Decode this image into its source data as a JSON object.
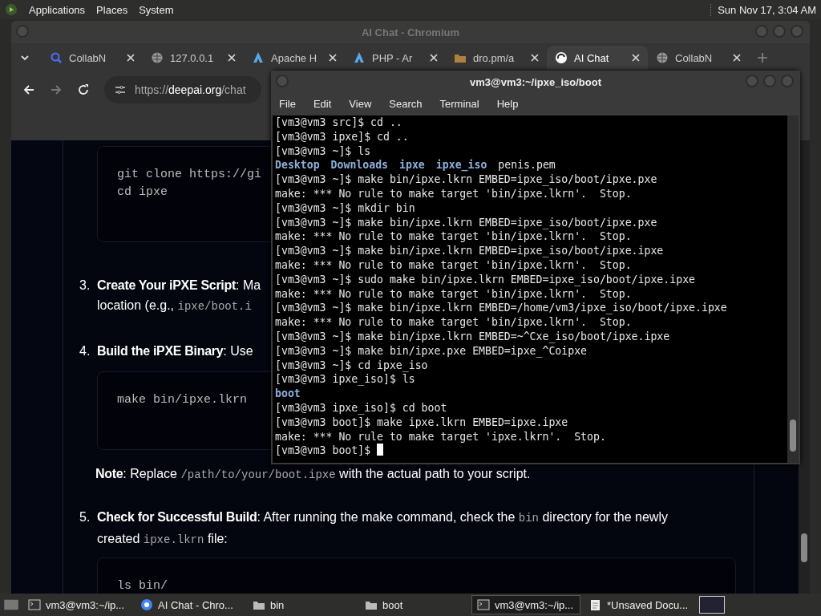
{
  "top_panel": {
    "menus": [
      "Applications",
      "Places",
      "System"
    ],
    "clock": "Sun Nov 17, 3:04 AM"
  },
  "browser": {
    "title": "AI Chat - Chromium",
    "tabs": [
      {
        "label": "CollabN",
        "kind": "search",
        "selected": false
      },
      {
        "label": "127.0.0.1",
        "kind": "globe",
        "selected": false
      },
      {
        "label": "Apache H",
        "kind": "feather",
        "selected": false
      },
      {
        "label": "PHP - Ar",
        "kind": "feather",
        "selected": false
      },
      {
        "label": "dro.pm/a",
        "kind": "folder",
        "selected": false
      },
      {
        "label": "AI Chat",
        "kind": "swirl",
        "selected": true
      },
      {
        "label": "CollabN",
        "kind": "globe",
        "selected": false
      }
    ],
    "address": {
      "scheme": "https://",
      "host": "deepai.org",
      "path": "/chat"
    },
    "content": [
      {
        "kind": "code",
        "lines": [
          "git clone https://gi",
          "cd ipxe"
        ]
      },
      {
        "kind": "item",
        "number": "3.",
        "lines": [
          [
            {
              "text": "Create Your iPXE Script",
              "kind": "bold"
            },
            {
              "text": ": Ma",
              "kind": "plain"
            }
          ],
          [
            {
              "text": "location (e.g., ",
              "kind": "plain"
            },
            {
              "text": "ipxe/boot.i",
              "kind": "code"
            }
          ]
        ]
      },
      {
        "kind": "item",
        "number": "4.",
        "lines": [
          [
            {
              "text": "Build the iPXE Binary",
              "kind": "bold"
            },
            {
              "text": ": Use",
              "kind": "plain"
            }
          ]
        ]
      },
      {
        "kind": "code",
        "lines": [
          "make bin/ipxe.lkrn"
        ]
      },
      {
        "kind": "note",
        "lines": [
          [
            {
              "text": "Note",
              "kind": "bold"
            },
            {
              "text": ": Replace ",
              "kind": "plain"
            },
            {
              "text": "/path/to/your/boot.ipxe",
              "kind": "code"
            },
            {
              "text": " with the actual path to your script.",
              "kind": "plain"
            }
          ]
        ]
      },
      {
        "kind": "item",
        "number": "5.",
        "lines": [
          [
            {
              "text": "Check for Successful Build",
              "kind": "bold"
            },
            {
              "text": ": After running the make command, check the ",
              "kind": "plain"
            },
            {
              "text": "bin",
              "kind": "code"
            },
            {
              "text": " directory for the newly",
              "kind": "plain"
            }
          ],
          [
            {
              "text": "created ",
              "kind": "plain"
            },
            {
              "text": "ipxe.lkrn",
              "kind": "code"
            },
            {
              "text": " file:",
              "kind": "plain"
            }
          ]
        ]
      },
      {
        "kind": "code",
        "lines": [
          "ls bin/"
        ]
      }
    ]
  },
  "terminal": {
    "title": "vm3@vm3:~/ipxe_iso/boot",
    "menus": [
      "File",
      "Edit",
      "View",
      "Search",
      "Terminal",
      "Help"
    ],
    "lines": [
      {
        "kind": "text",
        "text": "[vm3@vm3 src]$ cd .."
      },
      {
        "kind": "text",
        "text": "[vm3@vm3 ipxe]$ cd .."
      },
      {
        "kind": "text",
        "text": "[vm3@vm3 ~]$ ls"
      },
      {
        "kind": "listing",
        "items": [
          {
            "name": "Desktop",
            "kind": "dir"
          },
          {
            "name": "Downloads",
            "kind": "dir"
          },
          {
            "name": "ipxe",
            "kind": "dir"
          },
          {
            "name": "ipxe_iso",
            "kind": "dir"
          },
          {
            "name": "penis.pem",
            "kind": "file"
          }
        ]
      },
      {
        "kind": "text",
        "text": "[vm3@vm3 ~]$ make bin/ipxe.lkrn EMBED=ipxe_iso/boot/ipxe.pxe"
      },
      {
        "kind": "text",
        "text": "make: *** No rule to make target 'bin/ipxe.lkrn'.  Stop."
      },
      {
        "kind": "text",
        "text": "[vm3@vm3 ~]$ mkdir bin"
      },
      {
        "kind": "text",
        "text": "[vm3@vm3 ~]$ make bin/ipxe.lkrn EMBED=ipxe_iso/boot/ipxe.pxe"
      },
      {
        "kind": "text",
        "text": "make: *** No rule to make target 'bin/ipxe.lkrn'.  Stop."
      },
      {
        "kind": "text",
        "text": "[vm3@vm3 ~]$ make bin/ipxe.lkrn EMBED=ipxe_iso/boot/ipxe.ipxe"
      },
      {
        "kind": "text",
        "text": "make: *** No rule to make target 'bin/ipxe.lkrn'.  Stop."
      },
      {
        "kind": "text",
        "text": "[vm3@vm3 ~]$ sudo make bin/ipxe.lkrn EMBED=ipxe_iso/boot/ipxe.ipxe"
      },
      {
        "kind": "text",
        "text": "make: *** No rule to make target 'bin/ipxe.lkrn'.  Stop."
      },
      {
        "kind": "text",
        "text": "[vm3@vm3 ~]$ make bin/ipxe.lkrn EMBED=/home/vm3/ipxe_iso/boot/ipxe.ipxe"
      },
      {
        "kind": "text",
        "text": "make: *** No rule to make target 'bin/ipxe.lkrn'.  Stop."
      },
      {
        "kind": "text",
        "text": "[vm3@vm3 ~]$ make bin/ipxe.lkrn EMBED=~^Cxe_iso/boot/ipxe.ipxe"
      },
      {
        "kind": "text",
        "text": "[vm3@vm3 ~]$ make bin/ipxe.pxe EMBED=ipxe_^Coipxe"
      },
      {
        "kind": "text",
        "text": "[vm3@vm3 ~]$ cd ipxe_iso"
      },
      {
        "kind": "text",
        "text": "[vm3@vm3 ipxe_iso]$ ls"
      },
      {
        "kind": "listing",
        "items": [
          {
            "name": "boot",
            "kind": "dir"
          }
        ]
      },
      {
        "kind": "text",
        "text": "[vm3@vm3 ipxe_iso]$ cd boot"
      },
      {
        "kind": "text",
        "text": "[vm3@vm3 boot]$ make ipxe.lkrn EMBED=ipxe.ipxe"
      },
      {
        "kind": "text",
        "text": "make: *** No rule to make target 'ipxe.lkrn'.  Stop."
      },
      {
        "kind": "prompt",
        "text": "[vm3@vm3 boot]$ "
      }
    ]
  },
  "taskbar": {
    "items": [
      {
        "label": "vm3@vm3:~/ip...",
        "kind": "terminal",
        "selected": false
      },
      {
        "label": "AI Chat - Chro...",
        "kind": "browser",
        "selected": false
      },
      {
        "label": "bin",
        "kind": "folder",
        "selected": false
      },
      {
        "label": "boot",
        "kind": "folder",
        "selected": false
      },
      {
        "label": "vm3@vm3:~/ip...",
        "kind": "terminal",
        "selected": true
      },
      {
        "label": "*Unsaved Docu...",
        "kind": "editor",
        "selected": false
      }
    ]
  }
}
